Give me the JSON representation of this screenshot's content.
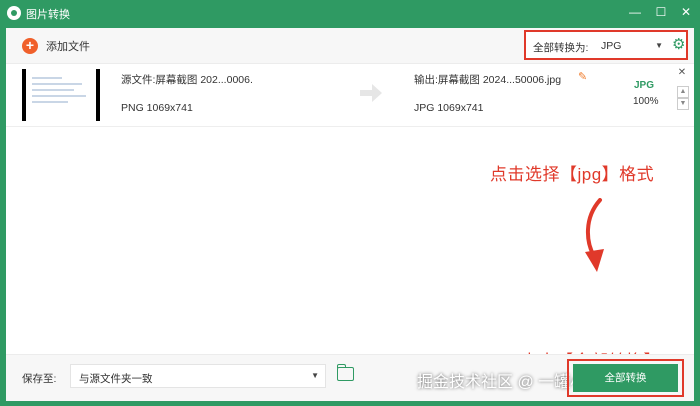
{
  "window": {
    "title": "图片转换",
    "minimize": "—",
    "maximize": "☐",
    "close": "✕"
  },
  "toolbar": {
    "add_label": "添加文件",
    "add_icon": "+",
    "format_label": "全部转换为:",
    "format_value": "JPG"
  },
  "file": {
    "src_name": "源文件:屏幕截图 202...0006.",
    "src_meta": "PNG  1069x741",
    "out_name": "输出:屏幕截图 2024...50006.jpg",
    "out_meta": "JPG  1069x741",
    "format_badge": "JPG",
    "progress": "100%"
  },
  "annotations": {
    "step1": "点击选择【jpg】格式",
    "step2": "点击【全部转换】"
  },
  "bottom": {
    "save_label": "保存至:",
    "save_value": "与源文件夹一致",
    "convert_label": "全部转换",
    "watermark": "掘金技术社区 @ 一罐小可乐"
  },
  "colors": {
    "brand": "#2f9a63",
    "accent": "#f0602b",
    "annotation": "#e0392a"
  }
}
